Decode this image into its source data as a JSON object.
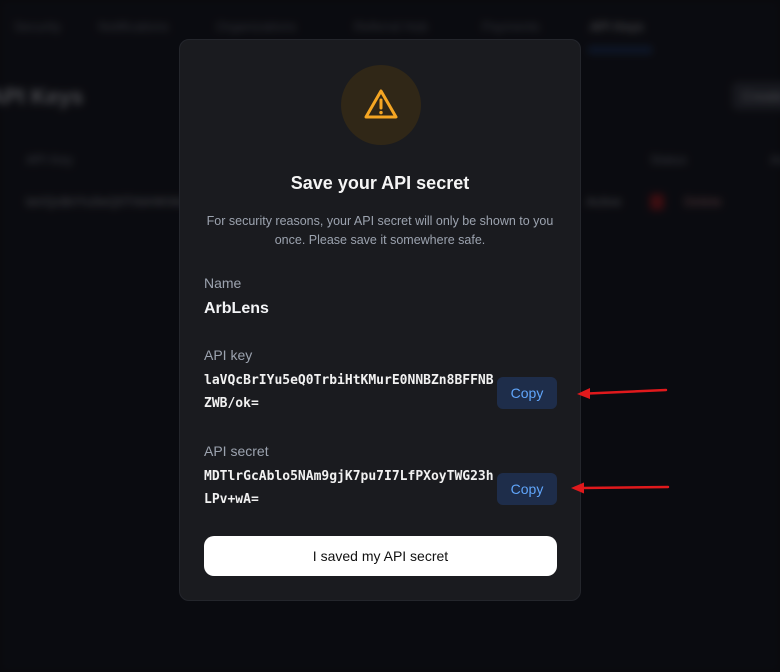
{
  "colors": {
    "background": "#0b0c10",
    "modal": "#1a1b1f",
    "warning": "#f5a623",
    "copy_text": "#60a5fa",
    "annotation_arrow": "#e0191c"
  },
  "background_app": {
    "tabs": [
      "Security",
      "Notifications",
      "Organizations",
      "Referral Hub",
      "Payments",
      "API Keys"
    ],
    "active_tab": "API Keys",
    "page_title": "API Keys",
    "action_button": "Create",
    "table_headers": [
      "API Key",
      "Status",
      "Actions"
    ],
    "row": {
      "key": "laVQcBrIYu5eQ0TrbiHtKMurE0",
      "status": "Active",
      "action": "Delete"
    }
  },
  "modal": {
    "icon": "warning-triangle-icon",
    "title": "Save your API secret",
    "description": "For security reasons, your API secret will only be shown to you once. Please save it somewhere safe.",
    "name_label": "Name",
    "name_value": "ArbLens",
    "api_key_label": "API key",
    "api_key_value": "laVQcBrIYu5eQ0TrbiHtKMurE0NNBZn8BFFNBZWB/ok=",
    "api_secret_label": "API secret",
    "api_secret_value": "MDTlrGcAblo5NAm9gjK7pu7I7LfPXoyTWG23hLPv+wA=",
    "copy_label": "Copy",
    "confirm_label": "I saved my API secret"
  },
  "annotations": [
    "arrow-to-copy-api-key",
    "arrow-to-copy-api-secret"
  ]
}
